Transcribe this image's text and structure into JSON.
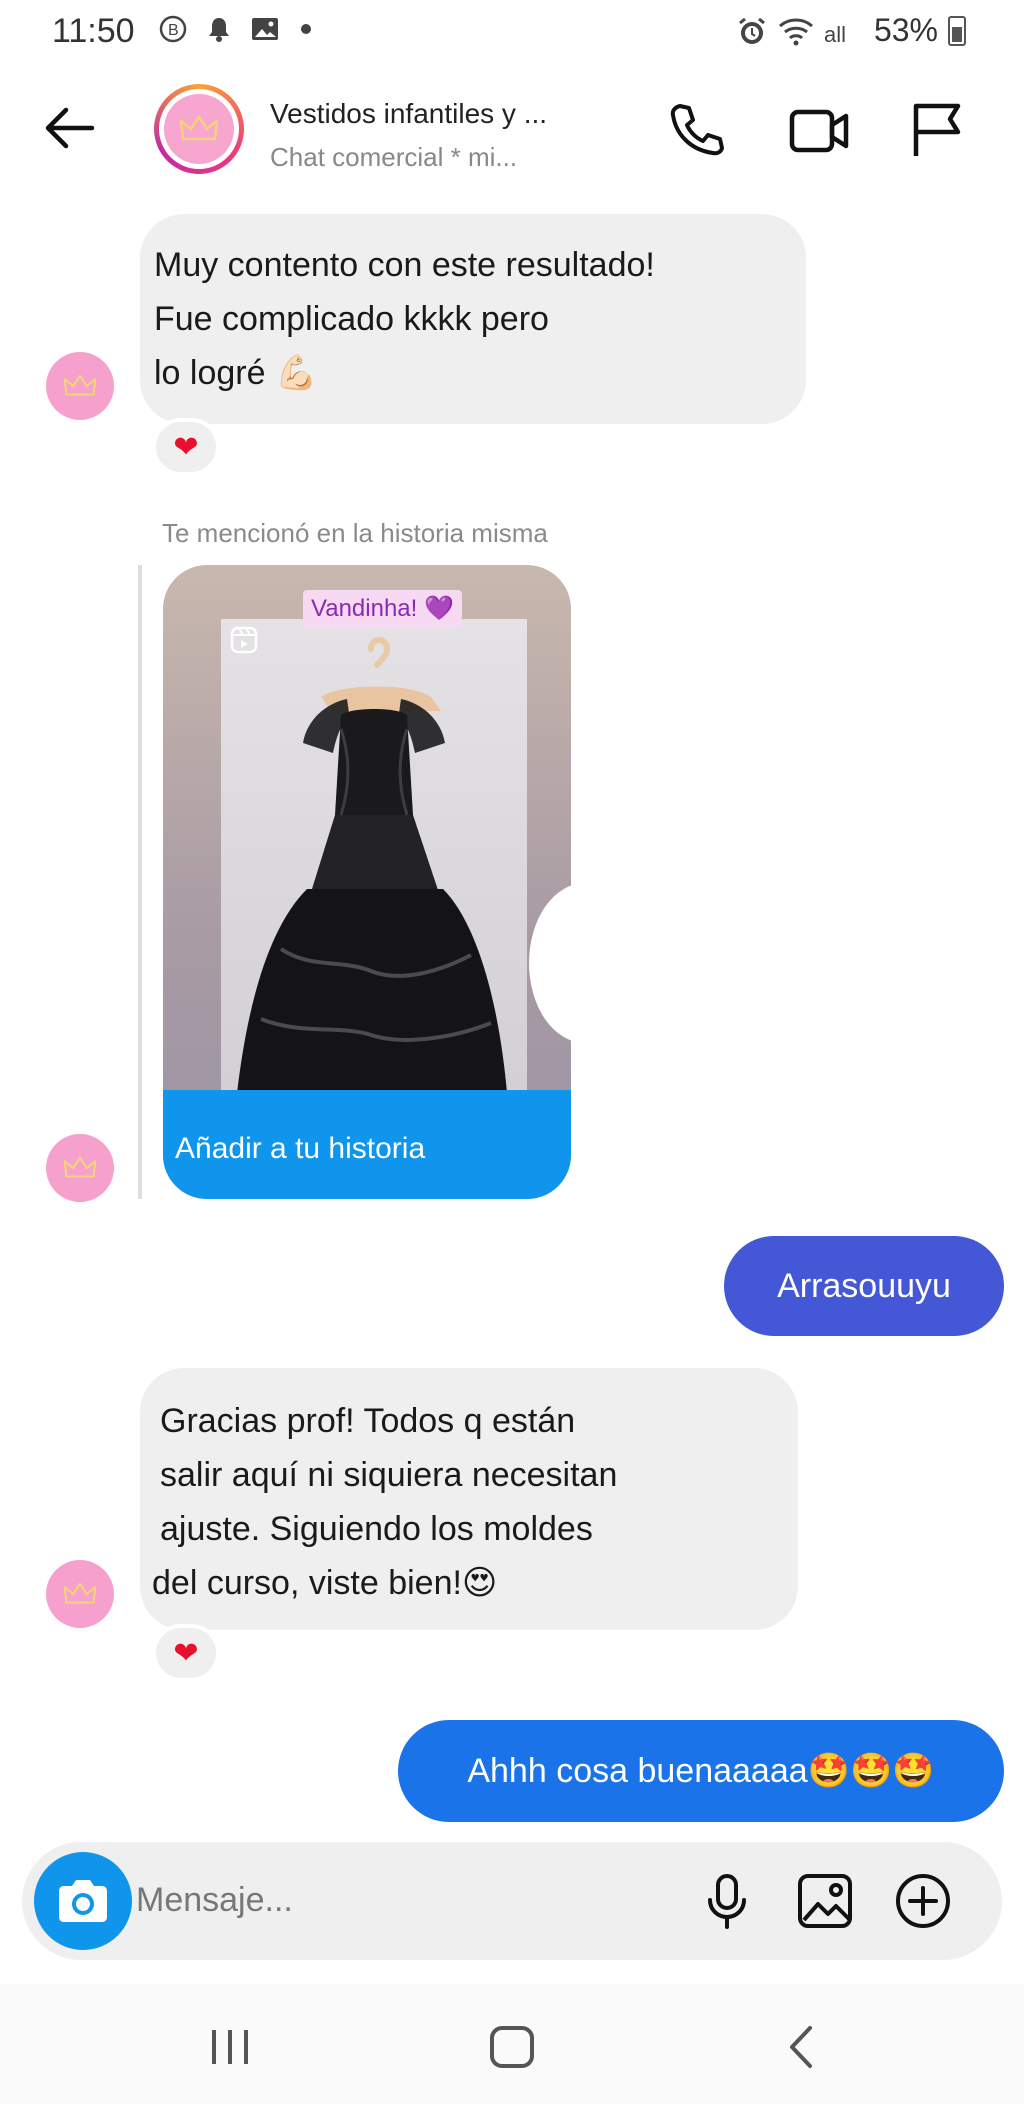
{
  "status_bar": {
    "time": "11:50",
    "battery": "53%",
    "icons_left": [
      "b-icon",
      "bell-icon",
      "image-icon",
      "dot-icon"
    ],
    "icons_right": [
      "alarm-icon",
      "wifi-icon",
      "signal-icon",
      "battery-icon"
    ]
  },
  "header": {
    "title": "Vestidos infantiles y ...",
    "subtitle": "Chat comercial * mi...",
    "icons": [
      "back-arrow-icon",
      "phone-icon",
      "video-icon",
      "flag-icon"
    ]
  },
  "messages": [
    {
      "lines": [
        "Muy contento con este resultado!",
        " Fue complicado kkkk pero",
        "lo logré 💪🏻"
      ],
      "reaction": "❤"
    },
    {
      "mention_label": "Te mencionó en la historia misma",
      "story_tag": "Vandinha! 💜",
      "story_cta": "Añadir a tu historia"
    },
    {
      "text": "Arrasouuyu",
      "color": "#4457d6"
    },
    {
      "lines": [
        "Gracias prof! Todos q están",
        "salir aquí ni siquiera necesitan",
        "ajuste. Siguiendo los moldes",
        "del curso, viste bien!😍"
      ],
      "reaction": "❤"
    },
    {
      "text": "Ahhh cosa buenaaaaa🤩🤩🤩",
      "color": "#1a73e8"
    }
  ],
  "composer": {
    "placeholder": "Mensaje...",
    "icons": [
      "camera-icon",
      "microphone-icon",
      "gallery-icon",
      "plus-circle-icon"
    ]
  },
  "nav": [
    "recents-icon",
    "home-icon",
    "back-icon"
  ]
}
